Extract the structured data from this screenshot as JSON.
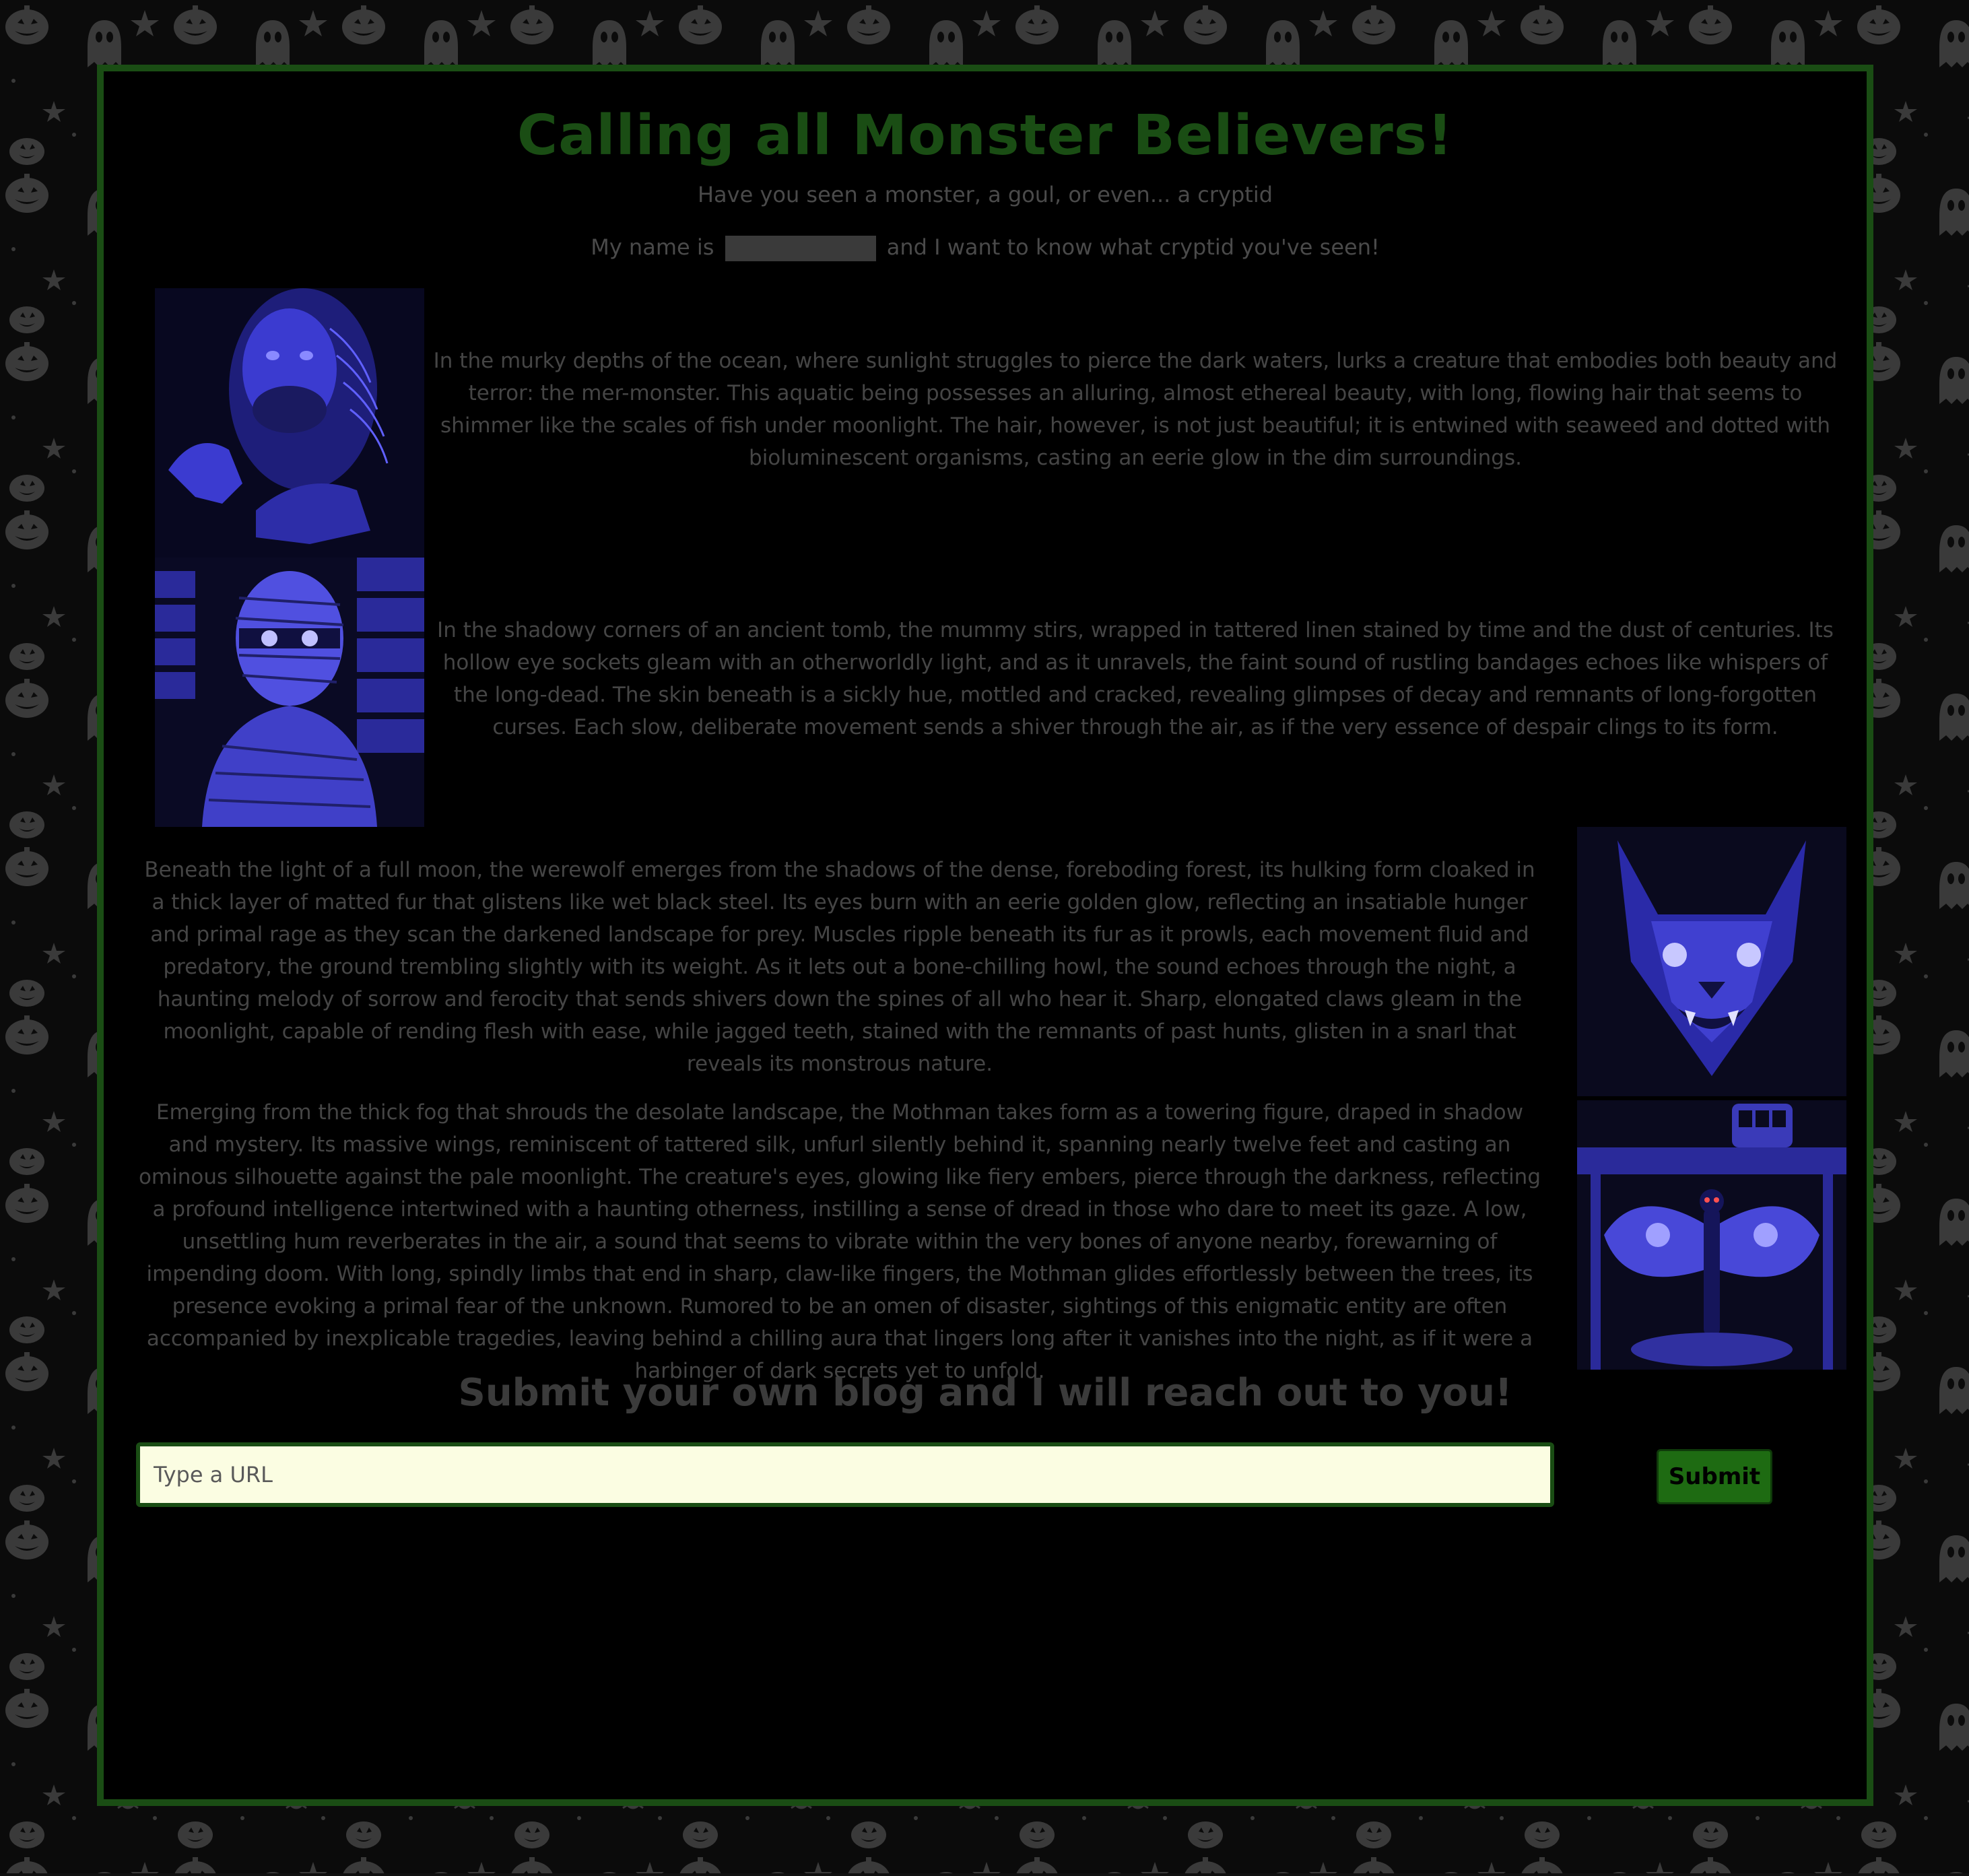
{
  "page": {
    "title": "Calling all Monster Believers!",
    "subtitle": "Have you seen a monster, a goul, or even... a cryptid",
    "name_prefix": "My name is",
    "name_suffix": "and I want to know what cryptid you've seen!"
  },
  "posts": [
    {
      "icon": "merman-creature-image",
      "text": "In the murky depths of the ocean, where sunlight struggles to pierce the dark waters, lurks a creature that embodies both beauty and terror: the mer-monster. This aquatic being possesses an alluring, almost ethereal beauty, with long, flowing hair that seems to shimmer like the scales of fish under moonlight. The hair, however, is not just beautiful; it is entwined with seaweed and dotted with bioluminescent organisms, casting an eerie glow in the dim surroundings."
    },
    {
      "icon": "mummy-image",
      "text": "In the shadowy corners of an ancient tomb, the mummy stirs, wrapped in tattered linen stained by time and the dust of centuries. Its hollow eye sockets gleam with an otherworldly light, and as it unravels, the faint sound of rustling bandages echoes like whispers of the long-dead. The skin beneath is a sickly hue, mottled and cracked, revealing glimpses of decay and remnants of long-forgotten curses. Each slow, deliberate movement sends a shiver through the air, as if the very essence of despair clings to its form."
    },
    {
      "icon": "werewolf-image",
      "text": "Beneath the light of a full moon, the werewolf emerges from the shadows of the dense, foreboding forest, its hulking form cloaked in a thick layer of matted fur that glistens like wet black steel. Its eyes burn with an eerie golden glow, reflecting an insatiable hunger and primal rage as they scan the darkened landscape for prey. Muscles ripple beneath its fur as it prowls, each movement fluid and predatory, the ground trembling slightly with its weight. As it lets out a bone-chilling howl, the sound echoes through the night, a haunting melody of sorrow and ferocity that sends shivers down the spines of all who hear it. Sharp, elongated claws gleam in the moonlight, capable of rending flesh with ease, while jagged teeth, stained with the remnants of past hunts, glisten in a snarl that reveals its monstrous nature."
    },
    {
      "icon": "mothman-image",
      "text": "Emerging from the thick fog that shrouds the desolate landscape, the Mothman takes form as a towering figure, draped in shadow and mystery. Its massive wings, reminiscent of tattered silk, unfurl silently behind it, spanning nearly twelve feet and casting an ominous silhouette against the pale moonlight. The creature's eyes, glowing like fiery embers, pierce through the darkness, reflecting a profound intelligence intertwined with a haunting otherness, instilling a sense of dread in those who dare to meet its gaze. A low, unsettling hum reverberates in the air, a sound that seems to vibrate within the very bones of anyone nearby, forewarning of impending doom. With long, spindly limbs that end in sharp, claw-like fingers, the Mothman glides effortlessly between the trees, its presence evoking a primal fear of the unknown. Rumored to be an omen of disaster, sightings of this enigmatic entity are often accompanied by inexplicable tragedies, leaving behind a chilling aura that lingers long after it vanishes into the night, as if it were a harbinger of dark secrets yet to unfold."
    }
  ],
  "submit": {
    "heading": "Submit your own blog and I will reach out to you!",
    "url_placeholder": "Type a URL",
    "url_value": "",
    "button_label": "Submit"
  },
  "colors": {
    "border": "#1a4d14",
    "title": "#1a4d14",
    "text": "#454545",
    "input_bg": "#fbfde2",
    "button_bg": "#1e6b12",
    "art": "#4d4dff"
  }
}
